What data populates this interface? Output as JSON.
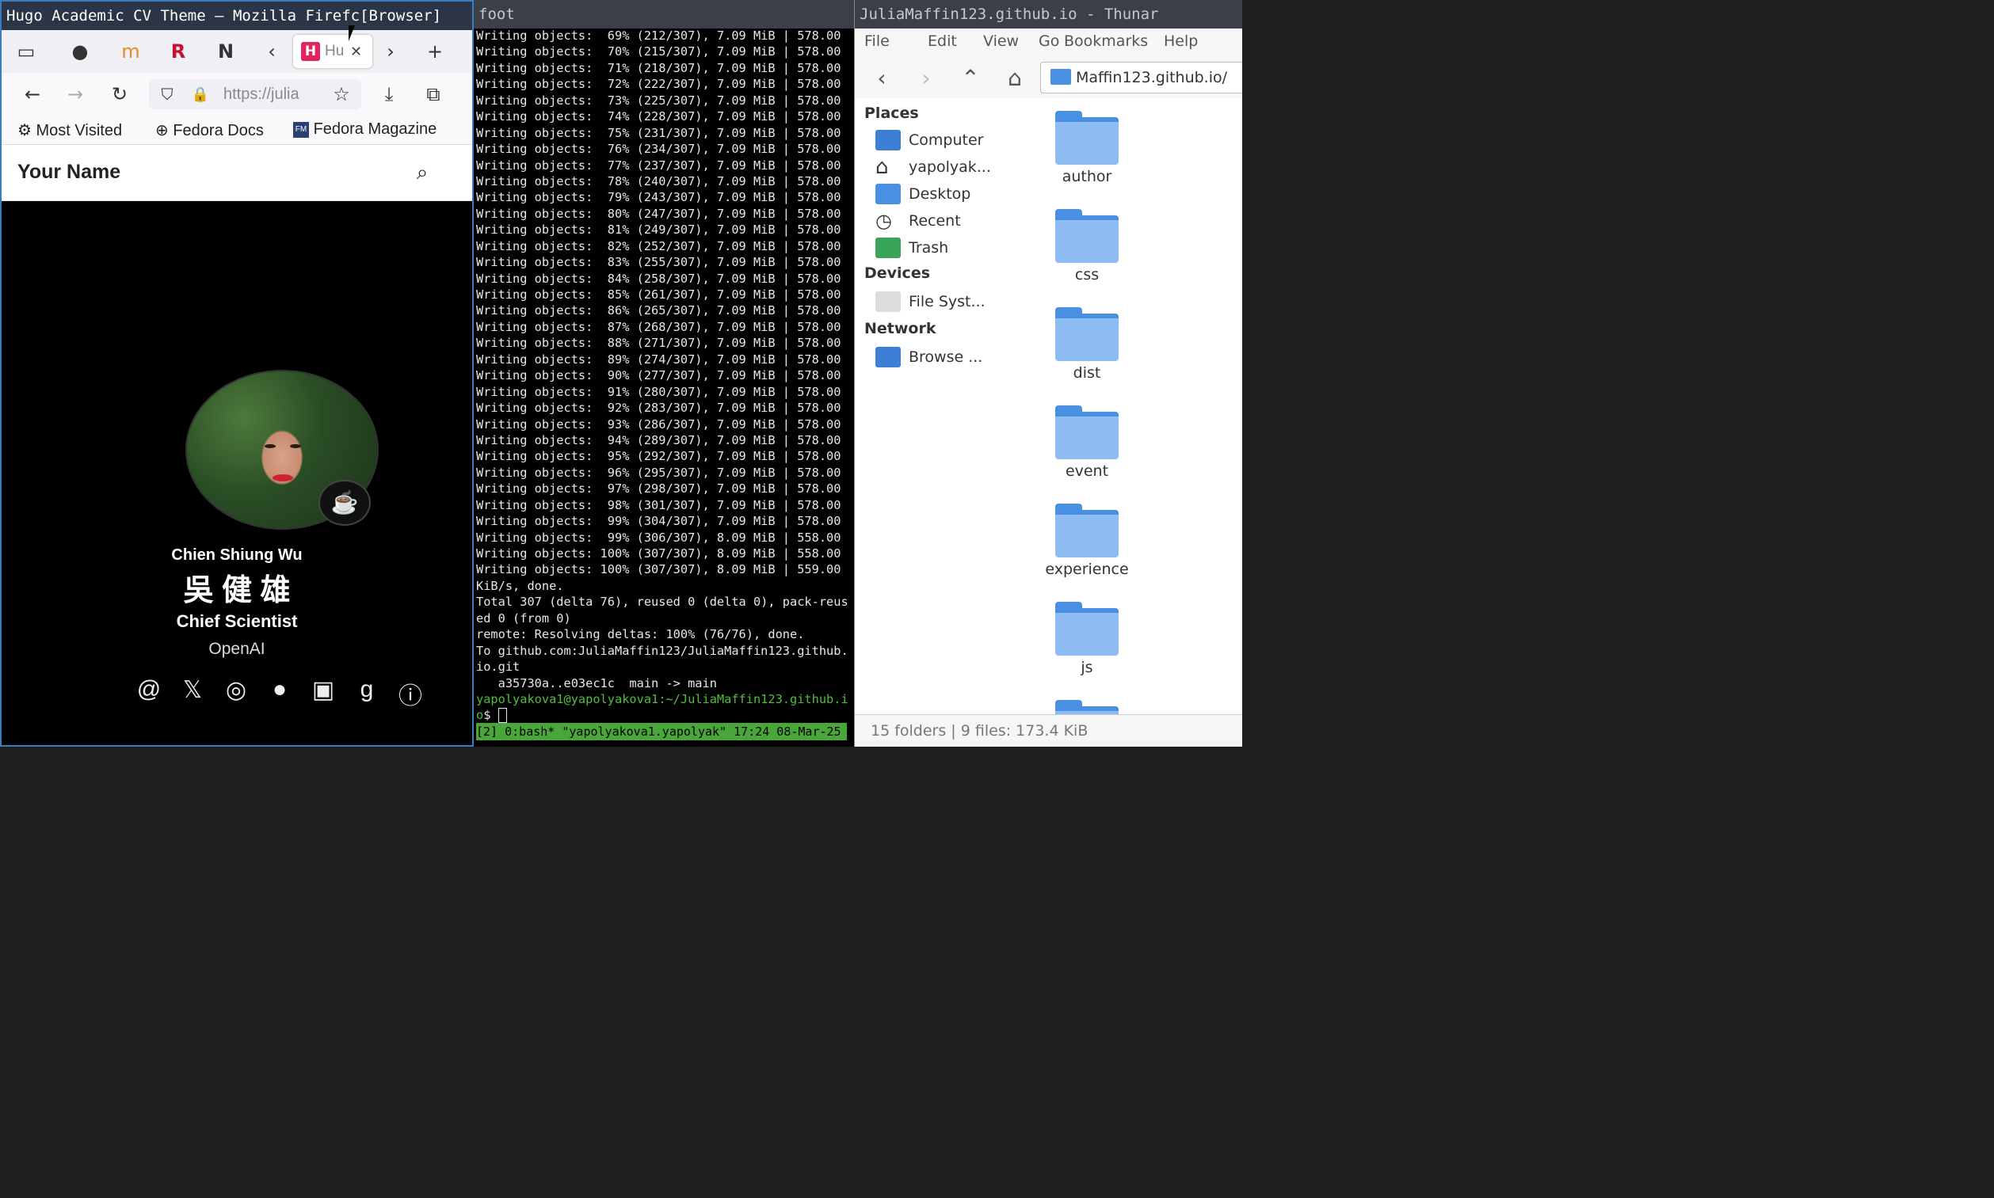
{
  "firefox": {
    "title": "Hugo Academic CV Theme — Mozilla Firefc[Browser]",
    "tab_title": "Hu",
    "url": "https://julia",
    "bookmarks": [
      "Most Visited",
      "Fedora Docs",
      "Fedora Magazine"
    ],
    "site_title": "Your Name",
    "person_name": "Chien Shiung Wu",
    "person_cjk": "吳 健 雄",
    "role": "Chief Scientist",
    "org": "OpenAI"
  },
  "terminal": {
    "title": "foot",
    "progress_lines": [
      "Writing objects:  69% (212/307), 7.09 MiB | 578.00",
      "Writing objects:  70% (215/307), 7.09 MiB | 578.00",
      "Writing objects:  71% (218/307), 7.09 MiB | 578.00",
      "Writing objects:  72% (222/307), 7.09 MiB | 578.00",
      "Writing objects:  73% (225/307), 7.09 MiB | 578.00",
      "Writing objects:  74% (228/307), 7.09 MiB | 578.00",
      "Writing objects:  75% (231/307), 7.09 MiB | 578.00",
      "Writing objects:  76% (234/307), 7.09 MiB | 578.00",
      "Writing objects:  77% (237/307), 7.09 MiB | 578.00",
      "Writing objects:  78% (240/307), 7.09 MiB | 578.00",
      "Writing objects:  79% (243/307), 7.09 MiB | 578.00",
      "Writing objects:  80% (247/307), 7.09 MiB | 578.00",
      "Writing objects:  81% (249/307), 7.09 MiB | 578.00",
      "Writing objects:  82% (252/307), 7.09 MiB | 578.00",
      "Writing objects:  83% (255/307), 7.09 MiB | 578.00",
      "Writing objects:  84% (258/307), 7.09 MiB | 578.00",
      "Writing objects:  85% (261/307), 7.09 MiB | 578.00",
      "Writing objects:  86% (265/307), 7.09 MiB | 578.00",
      "Writing objects:  87% (268/307), 7.09 MiB | 578.00",
      "Writing objects:  88% (271/307), 7.09 MiB | 578.00",
      "Writing objects:  89% (274/307), 7.09 MiB | 578.00",
      "Writing objects:  90% (277/307), 7.09 MiB | 578.00",
      "Writing objects:  91% (280/307), 7.09 MiB | 578.00",
      "Writing objects:  92% (283/307), 7.09 MiB | 578.00",
      "Writing objects:  93% (286/307), 7.09 MiB | 578.00",
      "Writing objects:  94% (289/307), 7.09 MiB | 578.00",
      "Writing objects:  95% (292/307), 7.09 MiB | 578.00",
      "Writing objects:  96% (295/307), 7.09 MiB | 578.00",
      "Writing objects:  97% (298/307), 7.09 MiB | 578.00",
      "Writing objects:  98% (301/307), 7.09 MiB | 578.00",
      "Writing objects:  99% (304/307), 7.09 MiB | 578.00",
      "Writing objects:  99% (306/307), 8.09 MiB | 558.00",
      "Writing objects: 100% (307/307), 8.09 MiB | 558.00",
      "Writing objects: 100% (307/307), 8.09 MiB | 559.00",
      "KiB/s, done.",
      "Total 307 (delta 76), reused 0 (delta 0), pack-reus",
      "ed 0 (from 0)",
      "remote: Resolving deltas: 100% (76/76), done.",
      "To github.com:JuliaMaffin123/JuliaMaffin123.github.",
      "io.git",
      "   a35730a..e03ec1c  main -> main"
    ],
    "prompt_line1": "yapolyakova1@yapolyakova1:~/JuliaMaffin123.github.i",
    "prompt_line2": "o",
    "prompt_suffix": "$ ",
    "tmux_status": "[2] 0:bash* \"yapolyakova1.yapolyak\" 17:24 08-Mar-25"
  },
  "thunar": {
    "title": "JuliaMaffin123.github.io - Thunar",
    "menu": [
      "File",
      "Edit",
      "View",
      "Go",
      "Bookmarks",
      "Help"
    ],
    "path": "Maffin123.github.io/",
    "places_header": "Places",
    "places": [
      "Computer",
      "yapolyak...",
      "Desktop",
      "Recent",
      "Trash"
    ],
    "devices_header": "Devices",
    "devices": [
      "File Syst..."
    ],
    "network_header": "Network",
    "network": [
      "Browse ..."
    ],
    "folders": [
      "author",
      "css",
      "dist",
      "event",
      "experience",
      "js"
    ],
    "status": "15 folders  |  9 files: 173.4 KiB"
  }
}
